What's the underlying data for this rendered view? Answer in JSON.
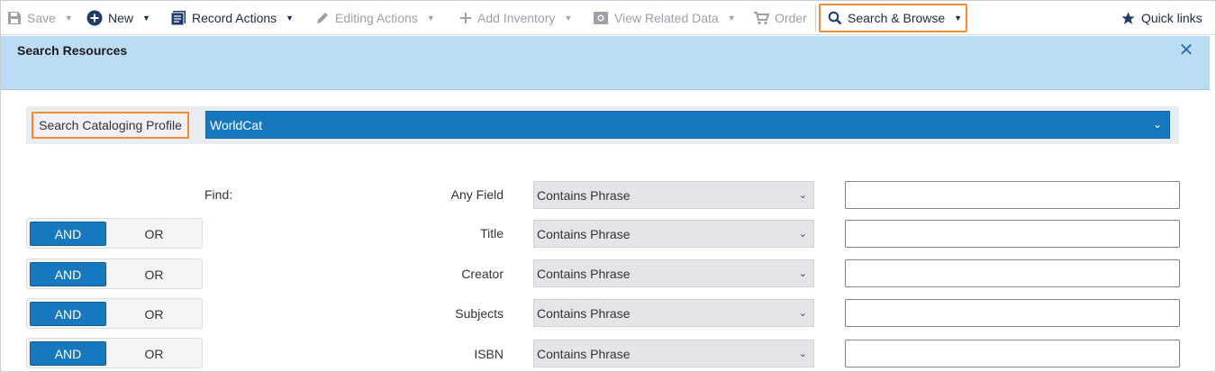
{
  "toolbar": {
    "save": "Save",
    "new": "New",
    "record_actions": "Record Actions",
    "editing_actions": "Editing Actions",
    "add_inventory": "Add Inventory",
    "view_related": "View Related Data",
    "order": "Order",
    "search_browse": "Search & Browse",
    "quick_links": "Quick links"
  },
  "banner": {
    "title": "Search Resources"
  },
  "profile": {
    "label": "Search Cataloging Profile",
    "value": "WorldCat"
  },
  "find_label": "Find:",
  "operators": {
    "and": "AND",
    "or": "OR"
  },
  "rows": [
    {
      "field": "Any Field",
      "condition": "Contains Phrase",
      "value": ""
    },
    {
      "field": "Title",
      "condition": "Contains Phrase",
      "value": ""
    },
    {
      "field": "Creator",
      "condition": "Contains Phrase",
      "value": ""
    },
    {
      "field": "Subjects",
      "condition": "Contains Phrase",
      "value": ""
    },
    {
      "field": "ISBN",
      "condition": "Contains Phrase",
      "value": ""
    }
  ],
  "colors": {
    "accent": "#1878be",
    "highlight": "#f08c34",
    "banner": "#bcdcf4"
  }
}
